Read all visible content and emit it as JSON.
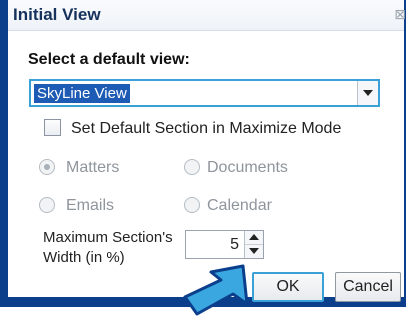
{
  "window": {
    "title": "Initial View",
    "close_glyph": "⊠"
  },
  "default_view": {
    "label": "Select a default view:",
    "selected": "SkyLine View"
  },
  "maximize_mode": {
    "label": "Set Default Section in Maximize Mode",
    "checked": false
  },
  "sections": [
    {
      "label": "Matters",
      "checked": true
    },
    {
      "label": "Documents",
      "checked": false
    },
    {
      "label": "Emails",
      "checked": false
    },
    {
      "label": "Calendar",
      "checked": false
    }
  ],
  "max_width": {
    "label_line1": "Maximum Section's",
    "label_line2": "Width (in %)",
    "value": "5"
  },
  "buttons": {
    "ok": "OK",
    "cancel": "Cancel"
  },
  "colors": {
    "frame": "#0b3f8c",
    "focus": "#3aa0d8",
    "selection": "#1d5bb5",
    "pointer_arrow": "#3aa7e0"
  },
  "icons": {
    "pointer": "pointer-arrow-icon",
    "close": "close-icon"
  }
}
